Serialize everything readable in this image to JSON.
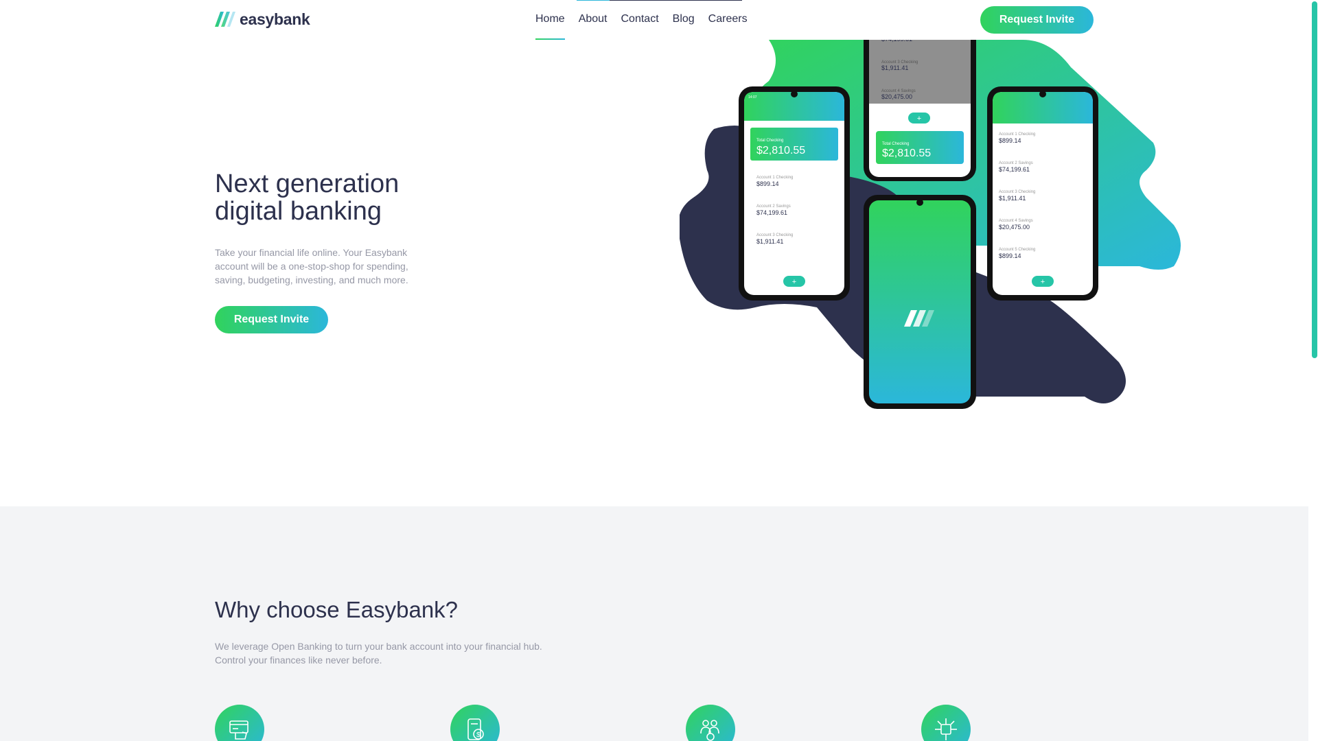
{
  "brand": {
    "name": "easybank"
  },
  "nav": {
    "items": [
      "Home",
      "About",
      "Contact",
      "Blog",
      "Careers"
    ],
    "active": "Home"
  },
  "header": {
    "cta_label": "Request Invite"
  },
  "hero": {
    "title_line1": "Next generation",
    "title_line2": "digital banking",
    "text": "Take your financial life online. Your Easybank account will be a one-stop-shop for spending, saving, budgeting, investing, and much more.",
    "cta_label": "Request Invite"
  },
  "phones": {
    "total_label": "Total Checking",
    "total_value": "$2,810.55",
    "accounts": [
      {
        "label": "Account 1 Checking",
        "value": "$899.14"
      },
      {
        "label": "Account 2 Savings",
        "value": "$74,199.61"
      },
      {
        "label": "Account 3 Checking",
        "value": "$1,911.41"
      },
      {
        "label": "Account 4 Savings",
        "value": "$20,475.00"
      },
      {
        "label": "Account 5 Checking",
        "value": "$899.14"
      }
    ],
    "time": "14:07"
  },
  "why": {
    "title": "Why choose Easybank?",
    "text_line1": "We leverage Open Banking to turn your bank account into your financial hub.",
    "text_line2": "Control your finances like never before.",
    "features": [
      {
        "icon": "online-banking-icon"
      },
      {
        "icon": "budgeting-icon"
      },
      {
        "icon": "onboarding-icon"
      },
      {
        "icon": "open-api-icon"
      }
    ]
  },
  "colors": {
    "primary_dark": "#2d314d",
    "accent_green": "#31d35c",
    "accent_cyan": "#2bb7da",
    "grayish_blue": "#9698a6",
    "light_bg": "#f3f4f6"
  }
}
